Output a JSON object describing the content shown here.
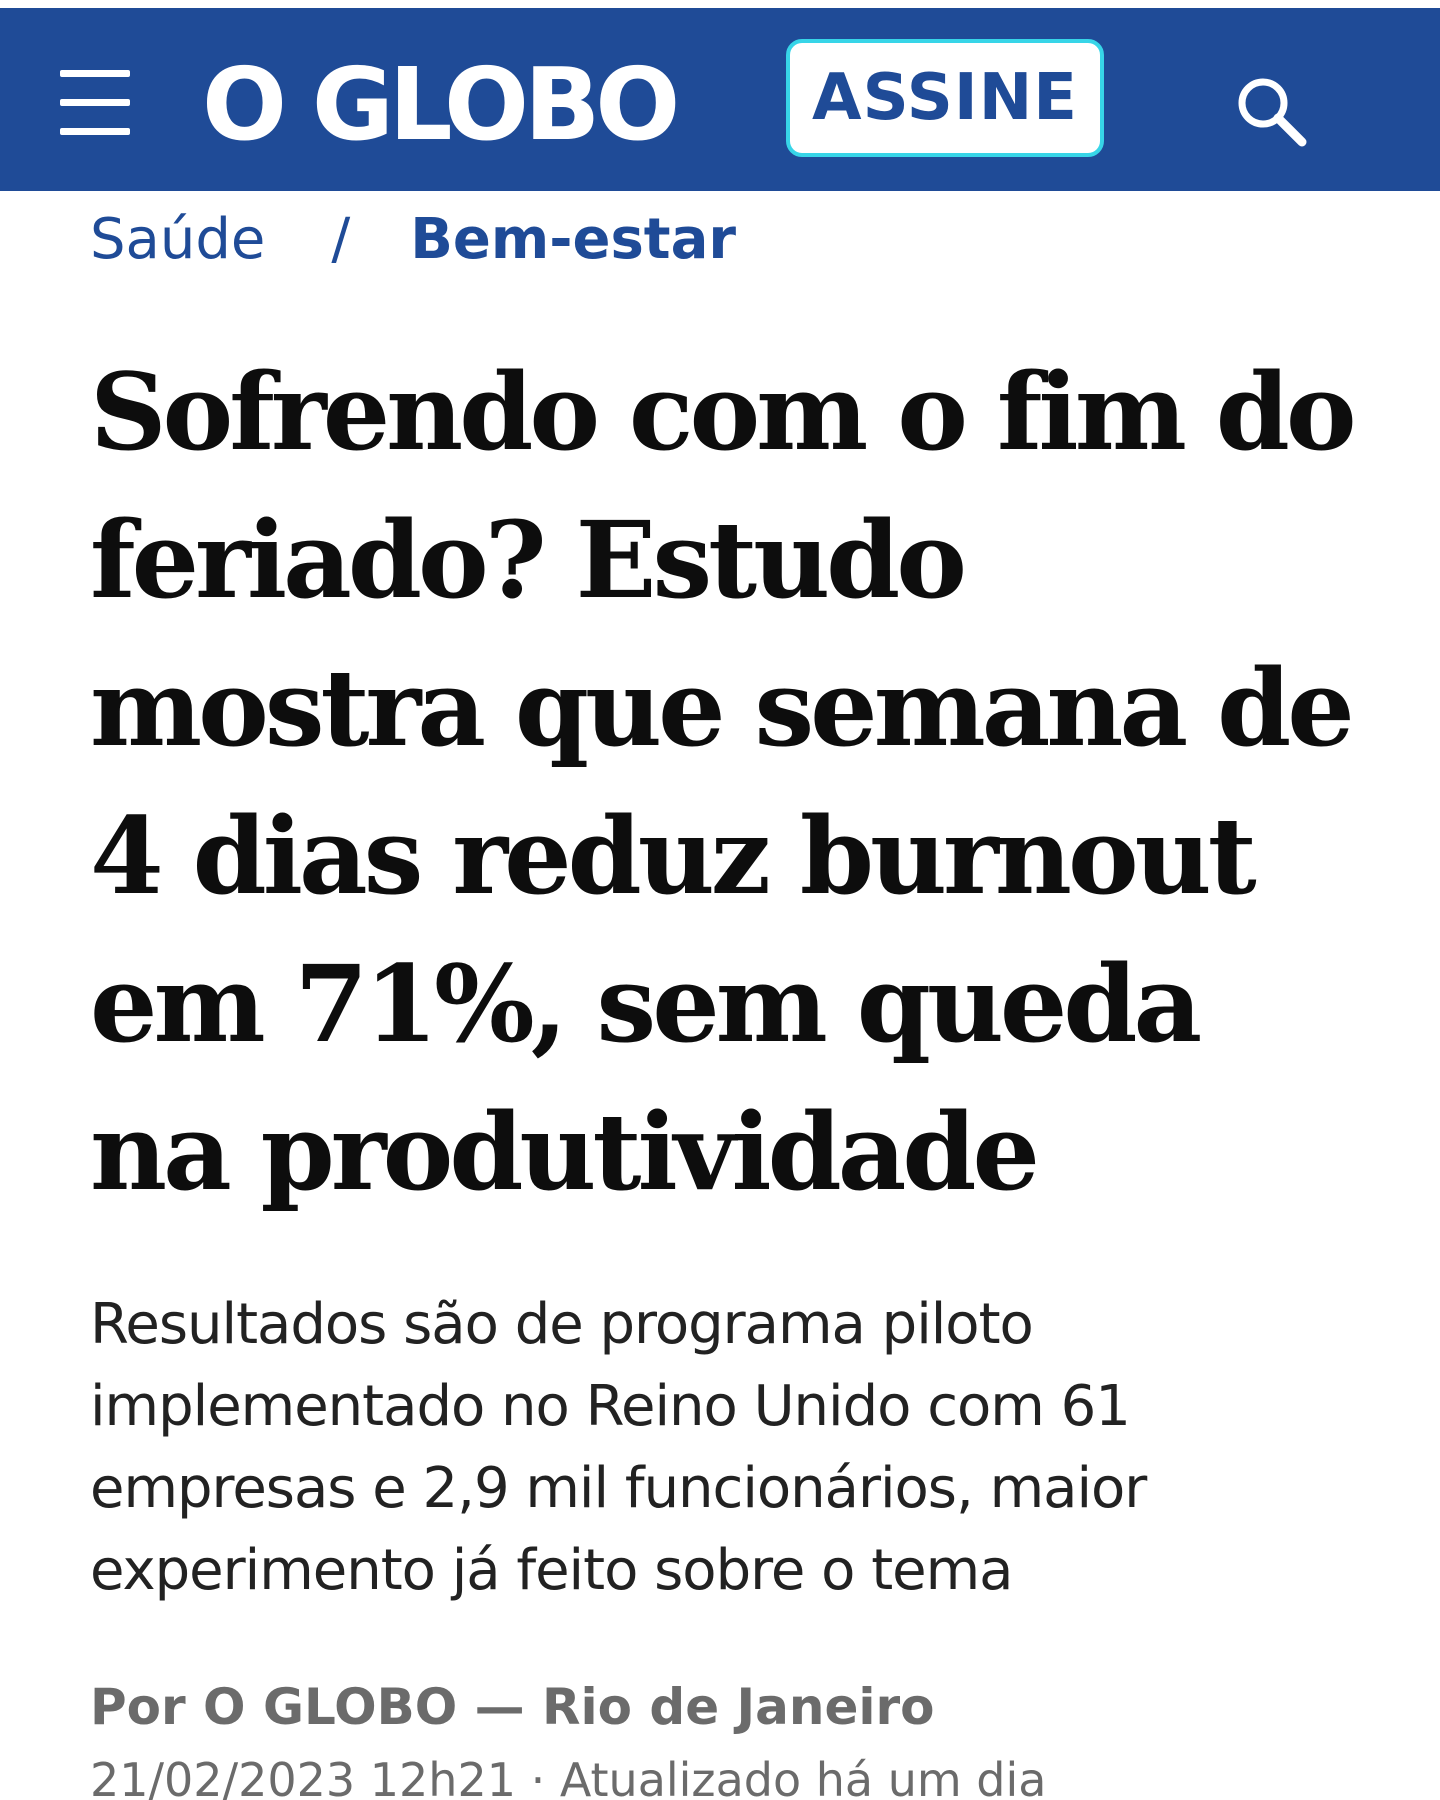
{
  "header": {
    "logo_text": "O GLOBO",
    "subscribe_label": "ASSINE",
    "menu_icon": "hamburger-menu-icon",
    "search_icon": "search-icon",
    "brand_color": "#1f4b97",
    "subscribe_border_color": "#37d5e8"
  },
  "breadcrumb": {
    "parent": "Saúde",
    "separator": "/",
    "current": "Bem-estar"
  },
  "article": {
    "headline": "Sofrendo com o fim do feriado? Estudo mostra que semana de 4 dias reduz burnout em 71%, sem queda na produtividade",
    "subtitle": "Resultados são de programa piloto implementado no Reino Unido com 61 empresas e 2,9 mil funcionários, maior experimento já feito sobre o tema",
    "byline": "Por O GLOBO — Rio de Janeiro",
    "dateline": "21/02/2023 12h21 · Atualizado há um dia"
  }
}
